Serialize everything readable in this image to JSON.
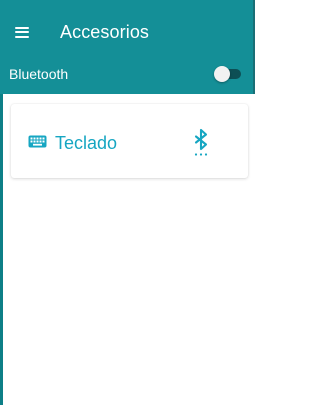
{
  "app_bar": {
    "title": "Accesorios",
    "menu_icon": "hamburger-menu-icon",
    "background_color": "#148f97"
  },
  "bluetooth": {
    "label": "Bluetooth",
    "toggle_state": "off"
  },
  "accessories": [
    {
      "label": "Teclado",
      "icon": "keyboard-icon",
      "status_icon": "bluetooth-searching-icon",
      "accent_color": "#16a6c2"
    }
  ]
}
